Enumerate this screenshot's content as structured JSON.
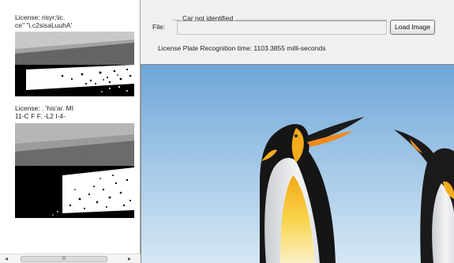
{
  "plates": [
    {
      "label_line1": "License: risyr;\\ic.",
      "label_line2": "ce'' \"i.c2sisaLuuhA'"
    },
    {
      "label_line1": "License: . 'his'ar. MI",
      "label_line2": "11-C F F. -L2 I-4-"
    }
  ],
  "scrollbar": {
    "left_arrow": "◂",
    "right_arrow": "▸",
    "thumb_grip": "III"
  },
  "main": {
    "car_status": "Car not identified",
    "file_label": "File:",
    "file_value": "",
    "load_button": "Load Image",
    "recognition_time": "License Plate Recognition time: 1103.3855 milli-seconds"
  },
  "colors": {
    "sky_top": "#7fb3e0",
    "sky_bottom": "#c9e0f2",
    "penguin_yellow": "#f2b51f",
    "beak_orange": "#f08a1c"
  }
}
